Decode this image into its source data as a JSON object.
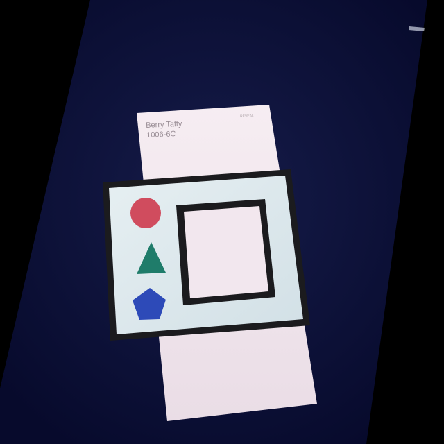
{
  "photo": {
    "background_color": "#000000",
    "table_color": "#0a0f3a"
  },
  "paint_swatch": {
    "name": "Berry Taffy",
    "code": "1006-6C",
    "series_label": "REVEAL",
    "color": "#f1e6ee"
  },
  "shape_card": {
    "card_color": "#dde9ee",
    "frame_color": "#1b1b1e",
    "shapes": [
      {
        "shape": "circle",
        "color": "#d04c5e"
      },
      {
        "shape": "triangle",
        "color": "#1f7c6a"
      },
      {
        "shape": "pentagon",
        "color": "#2d4ab8"
      }
    ]
  }
}
